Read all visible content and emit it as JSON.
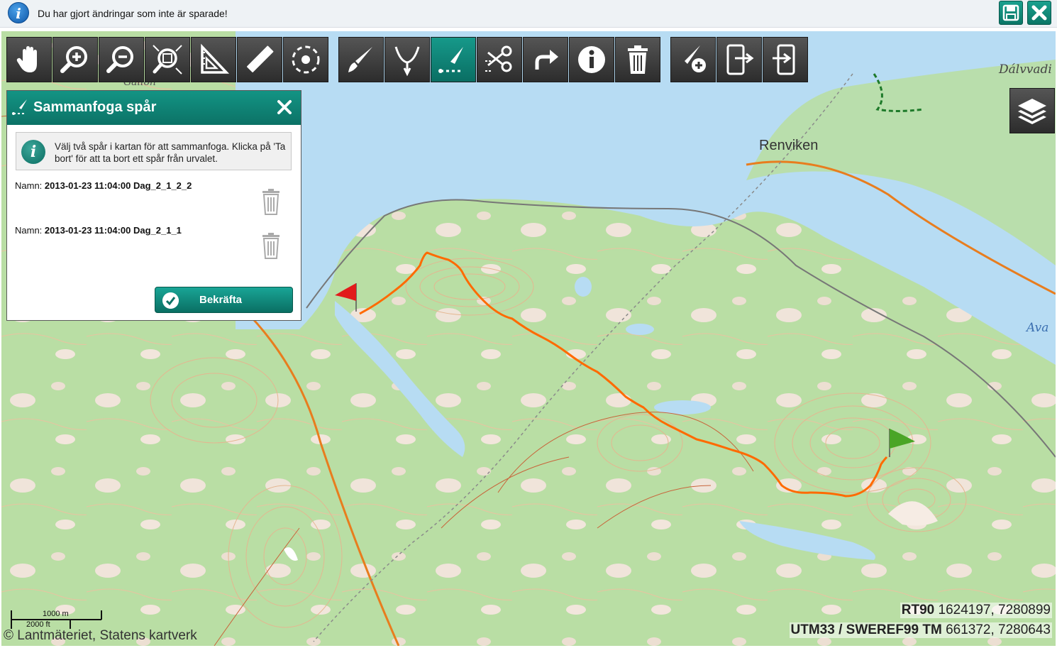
{
  "notification": {
    "message": "Du har gjort ändringar som inte är sparade!",
    "info_icon_glyph": "i"
  },
  "toolbar": {
    "groups": [
      [
        "hand-pan-icon",
        "zoom-in-icon",
        "zoom-out-icon",
        "zoom-extent-icon",
        "set-square-icon",
        "ruler-icon",
        "circle-select-icon"
      ],
      [
        "brush-draw-icon",
        "split-fork-icon",
        "merge-track-icon",
        "scissors-cut-icon",
        "redo-arrow-icon",
        "info-icon",
        "trash-icon"
      ],
      [
        "add-marker-icon",
        "export-device-icon",
        "import-device-icon"
      ]
    ],
    "active": "merge-track-icon"
  },
  "panel": {
    "title": "Sammanfoga spår",
    "info_text": "Välj två spår i kartan för att sammanfoga. Klicka på 'Ta bort' för att ta bort ett spår från urvalet.",
    "name_label": "Namn:",
    "tracks": [
      {
        "name": "2013-01-23 11:04:00 Dag_2_1_2_2"
      },
      {
        "name": "2013-01-23 11:04:00 Dag_2_1_1"
      }
    ],
    "confirm_label": "Bekräfta"
  },
  "map": {
    "place_labels": [
      "Renviken",
      "Dálvvadi",
      "Ava",
      "Gallon"
    ],
    "coordinates": [
      {
        "system": "RT90",
        "value": "1624197, 7280899"
      },
      {
        "system": "UTM33 / SWEREF99 TM",
        "value": "661372, 7280643"
      }
    ],
    "scale_metric": "1000 m",
    "scale_imperial": "2000 ft",
    "copyright": "© Lantmäteriet, Statens kartverk"
  },
  "colors": {
    "accent": "#0c7266",
    "track": "#ff6a00",
    "land": "#b9dea4",
    "water": "#b7dcf3",
    "toolbar": "#3a3a3a"
  }
}
